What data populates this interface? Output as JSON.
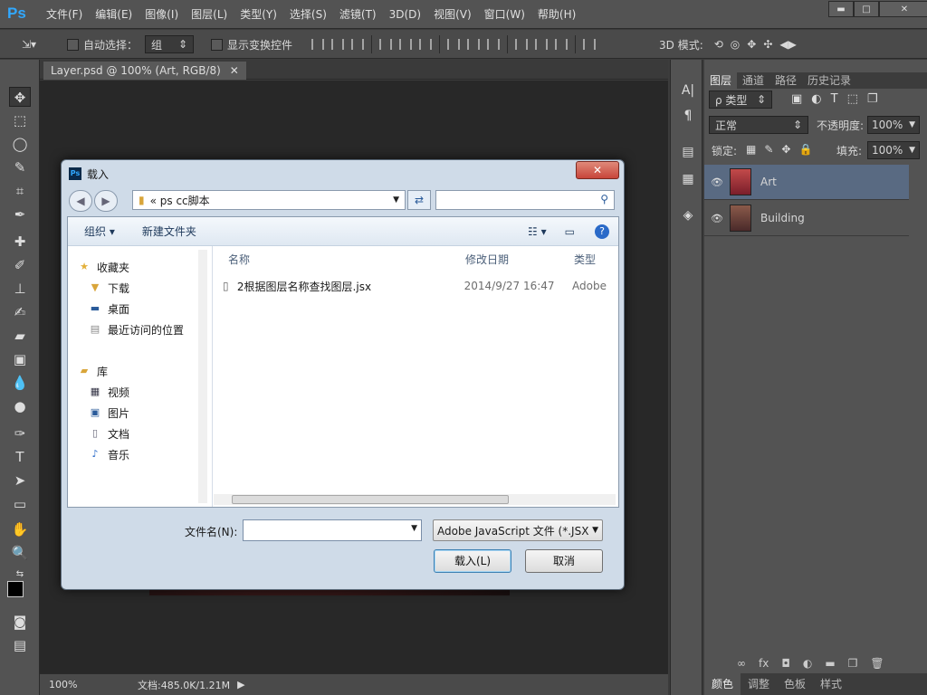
{
  "app": {
    "logo": "Ps",
    "menus": [
      "文件(F)",
      "编辑(E)",
      "图像(I)",
      "图层(L)",
      "类型(Y)",
      "选择(S)",
      "滤镜(T)",
      "3D(D)",
      "视图(V)",
      "窗口(W)",
      "帮助(H)"
    ]
  },
  "options": {
    "auto_select_label": "自动选择：",
    "auto_select_value": "组",
    "show_transform_label": "显示变换控件",
    "mode_3d_label": "3D 模式:"
  },
  "document": {
    "tab_title": "Layer.psd @ 100% (Art, RGB/8)",
    "zoom": "100%",
    "doc_info": "文档:485.0K/1.21M"
  },
  "panels": {
    "tabs": [
      "图层",
      "通道",
      "路径",
      "历史记录"
    ],
    "filter_kind": "ρ 类型",
    "blend_mode": "正常",
    "opacity_label": "不透明度:",
    "opacity_value": "100%",
    "lock_label": "锁定:",
    "fill_label": "填充:",
    "fill_value": "100%",
    "layers": [
      {
        "name": "Art"
      },
      {
        "name": "Building"
      }
    ],
    "bottom_tabs": [
      "颜色",
      "调整",
      "色板",
      "样式"
    ]
  },
  "dialog": {
    "title": "载入",
    "address": "«  ps cc脚本",
    "organize": "组织 ▾",
    "new_folder": "新建文件夹",
    "nav": {
      "favorites": "收藏夹",
      "favorites_items": [
        "下载",
        "桌面",
        "最近访问的位置"
      ],
      "libraries": "库",
      "library_items": [
        "视频",
        "图片",
        "文档",
        "音乐"
      ]
    },
    "columns": {
      "name": "名称",
      "date": "修改日期",
      "type": "类型"
    },
    "file": {
      "name": "2根据图层名称查找图层.jsx",
      "date": "2014/9/27 16:47",
      "type": "Adobe"
    },
    "filename_label": "文件名(N):",
    "filename_value": "",
    "filetype": "Adobe JavaScript 文件 (*.JSX",
    "load_button": "载入(L)",
    "cancel_button": "取消"
  }
}
